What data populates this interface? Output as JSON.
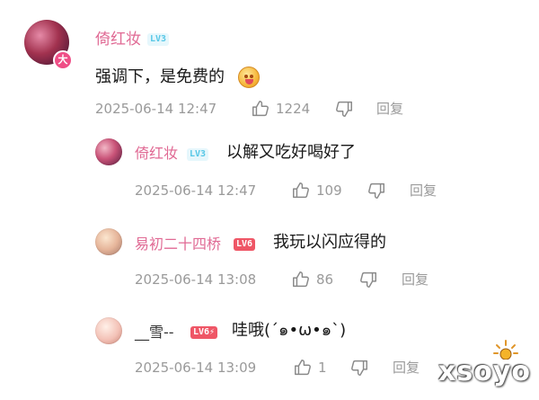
{
  "comment": {
    "author": "倚红妆",
    "level": "LV3",
    "host_badge": "大",
    "text": "强调下，是免费的",
    "emoji": "grinning-face-emoji",
    "time": "2025-06-14 12:47",
    "likes": "1224",
    "reply_label": "回复"
  },
  "replies": [
    {
      "author": "倚红妆",
      "level": "LV3",
      "text": "以解又吃好喝好了",
      "time": "2025-06-14 12:47",
      "likes": "109",
      "reply_label": "回复"
    },
    {
      "author": "易初二十四桥",
      "level": "LV6",
      "text": "我玩以闪应得的",
      "time": "2025-06-14 13:08",
      "likes": "86",
      "reply_label": "回复"
    },
    {
      "author": "__雪--",
      "level": "LV6⚡",
      "text": "哇哦(´๑•ω•๑`)",
      "time": "2025-06-14 13:09",
      "likes": "1",
      "reply_label": "回复"
    }
  ],
  "watermark": "xsoyo",
  "colors": {
    "username_pink": "#e06a94",
    "level_cyan": "#57c7e6",
    "level_red": "#ef5666",
    "meta_gray": "#9a9a9a"
  }
}
